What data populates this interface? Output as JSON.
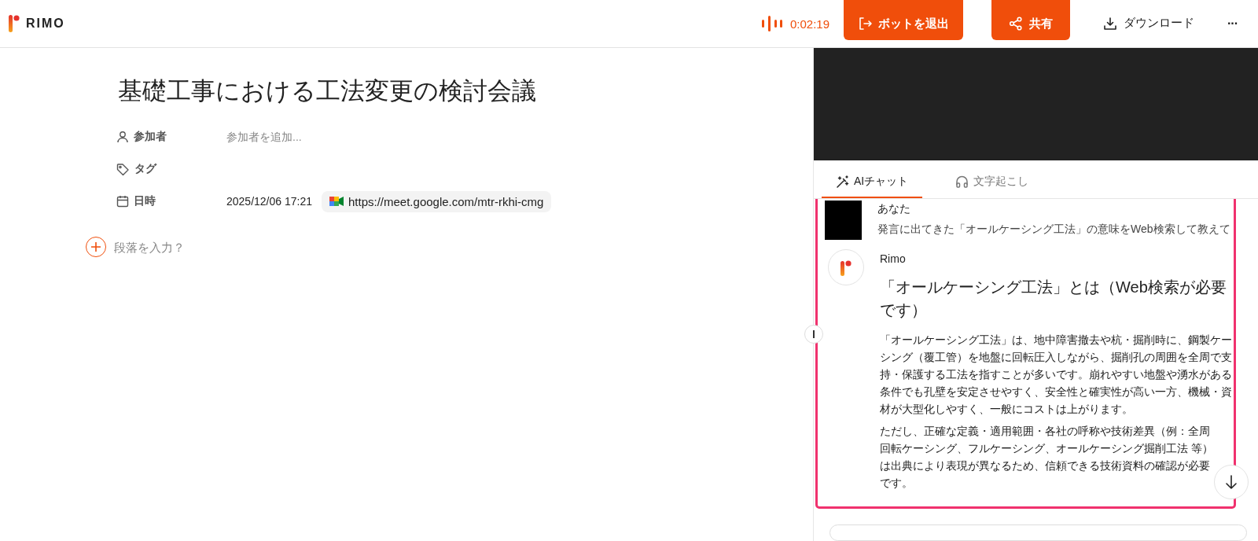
{
  "header": {
    "logo": "RIMO",
    "recording": {
      "time": "0:02:19"
    },
    "buttons": [
      {
        "kind": "primary",
        "label": "ボットを退出"
      },
      {
        "kind": "primary",
        "label": "共有"
      },
      {
        "kind": "plain",
        "label": "ダウンロード"
      },
      {
        "kind": "more",
        "label": "···"
      }
    ]
  },
  "meeting": {
    "title": "基礎工事における工法変更の検討会議",
    "fields": [
      {
        "label": "参加者",
        "placeholder": "参加者を追加..."
      },
      {
        "label": "タグ"
      },
      {
        "label": "日時",
        "value": "2025/12/06 17:21",
        "link": "https://meet.google.com/mtr-rkhi-cmg"
      }
    ],
    "paragraph_placeholder": "段落を入力？"
  },
  "side_panel": {
    "tabs": [
      {
        "label": "AIチャット",
        "selected": true
      },
      {
        "label": "文字起こし",
        "selected": false
      }
    ],
    "messages": [
      {
        "kind": "user",
        "author": "あなた",
        "text": "発言に出てきた「オールケーシング工法」の意味をWeb検索して教えて"
      },
      {
        "kind": "bot",
        "author": "Rimo",
        "heading": "「オールケーシング工法」とは（Web検索が必要です）",
        "paragraphs": [
          "「オールケーシング工法」は、地中障害撤去や杭・掘削時に、鋼製ケーシング（覆工管）を地盤に回転圧入しながら、掘削孔の周囲を全周で支持・保護する工法を指すことが多いです。崩れやすい地盤や湧水がある条件でも孔壁を安定させやすく、安全性と確実性が高い一方、機械・資材が大型化しやすく、一般にコストは上がります。",
          "ただし、正確な定義・適用範囲・各社の呼称や技術差異（例：全周回転ケーシング、フルケーシング、オールケーシング掘削工法 等）は出典により表現が異なるため、信頼できる技術資料の確認が必要です。"
        ]
      }
    ]
  }
}
